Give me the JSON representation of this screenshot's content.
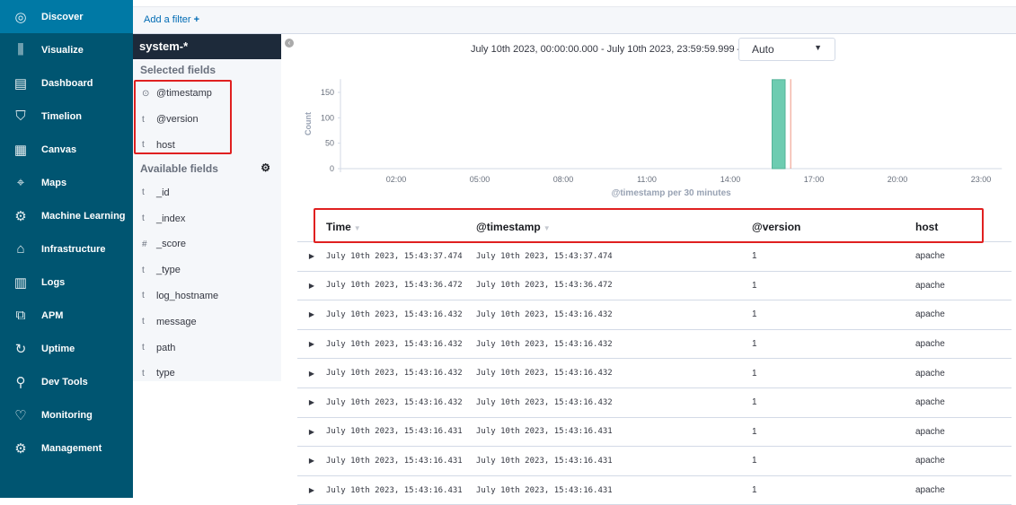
{
  "nav": [
    {
      "label": "Discover",
      "icon": "compass-icon",
      "glyph": "◎",
      "active": true
    },
    {
      "label": "Visualize",
      "icon": "visualize-icon",
      "glyph": "⫼"
    },
    {
      "label": "Dashboard",
      "icon": "dashboard-icon",
      "glyph": "▤"
    },
    {
      "label": "Timelion",
      "icon": "timelion-icon",
      "glyph": "⛉"
    },
    {
      "label": "Canvas",
      "icon": "canvas-icon",
      "glyph": "▦"
    },
    {
      "label": "Maps",
      "icon": "maps-icon",
      "glyph": "⌖"
    },
    {
      "label": "Machine Learning",
      "icon": "machine-learning-icon",
      "glyph": "⚙"
    },
    {
      "label": "Infrastructure",
      "icon": "infrastructure-icon",
      "glyph": "⌂"
    },
    {
      "label": "Logs",
      "icon": "logs-icon",
      "glyph": "▥"
    },
    {
      "label": "APM",
      "icon": "apm-icon",
      "glyph": "⧉"
    },
    {
      "label": "Uptime",
      "icon": "uptime-icon",
      "glyph": "↻"
    },
    {
      "label": "Dev Tools",
      "icon": "wrench-icon",
      "glyph": "⚲"
    },
    {
      "label": "Monitoring",
      "icon": "heartbeat-icon",
      "glyph": "♡"
    },
    {
      "label": "Management",
      "icon": "gear-icon",
      "glyph": "⚙"
    }
  ],
  "filter": {
    "add_label": "Add a filter",
    "plus": "+"
  },
  "fields": {
    "index": "system-*",
    "selected_title": "Selected fields",
    "selected": [
      {
        "type": "⊙",
        "name": "@timestamp"
      },
      {
        "type": "t",
        "name": "@version"
      },
      {
        "type": "t",
        "name": "host"
      }
    ],
    "available_title": "Available fields",
    "available": [
      {
        "type": "t",
        "name": "_id"
      },
      {
        "type": "t",
        "name": "_index"
      },
      {
        "type": "#",
        "name": "_score"
      },
      {
        "type": "t",
        "name": "_type"
      },
      {
        "type": "t",
        "name": "log_hostname"
      },
      {
        "type": "t",
        "name": "message"
      },
      {
        "type": "t",
        "name": "path"
      },
      {
        "type": "t",
        "name": "type"
      }
    ]
  },
  "time_range": "July 10th 2023, 00:00:00.000 - July 10th 2023, 23:59:59.999 —",
  "interval": {
    "selected": "Auto"
  },
  "chart_data": {
    "type": "bar",
    "xlabel": "@timestamp per 30 minutes",
    "ylabel": "Count",
    "x_ticks": [
      "02:00",
      "05:00",
      "08:00",
      "11:00",
      "14:00",
      "17:00",
      "20:00",
      "23:00"
    ],
    "y_ticks": [
      0,
      50,
      100,
      150
    ],
    "ylim": [
      0,
      176
    ],
    "xlim": [
      "00:00",
      "23:45"
    ],
    "bars": [
      {
        "start": "15:30",
        "end": "16:00",
        "value": 175
      }
    ],
    "current_time_marker": "16:10",
    "bar_color": "#6dccb1",
    "marker_color": "#e7664c"
  },
  "table": {
    "headers": [
      "Time",
      "@timestamp",
      "@version",
      "host"
    ],
    "rows": [
      [
        "July 10th 2023, 15:43:37.474",
        "July 10th 2023, 15:43:37.474",
        "1",
        "apache"
      ],
      [
        "July 10th 2023, 15:43:36.472",
        "July 10th 2023, 15:43:36.472",
        "1",
        "apache"
      ],
      [
        "July 10th 2023, 15:43:16.432",
        "July 10th 2023, 15:43:16.432",
        "1",
        "apache"
      ],
      [
        "July 10th 2023, 15:43:16.432",
        "July 10th 2023, 15:43:16.432",
        "1",
        "apache"
      ],
      [
        "July 10th 2023, 15:43:16.432",
        "July 10th 2023, 15:43:16.432",
        "1",
        "apache"
      ],
      [
        "July 10th 2023, 15:43:16.432",
        "July 10th 2023, 15:43:16.432",
        "1",
        "apache"
      ],
      [
        "July 10th 2023, 15:43:16.431",
        "July 10th 2023, 15:43:16.431",
        "1",
        "apache"
      ],
      [
        "July 10th 2023, 15:43:16.431",
        "July 10th 2023, 15:43:16.431",
        "1",
        "apache"
      ],
      [
        "July 10th 2023, 15:43:16.431",
        "July 10th 2023, 15:43:16.431",
        "1",
        "apache"
      ]
    ]
  }
}
